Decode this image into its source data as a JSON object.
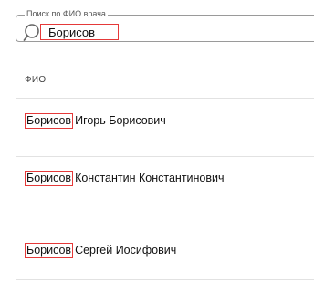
{
  "search": {
    "legend": "Поиск по ФИО врача",
    "value": "Борисов"
  },
  "table": {
    "column_header": "ФИО",
    "rows": [
      {
        "match": "Борисов",
        "rest": "Игорь Борисович"
      },
      {
        "match": "Борисов",
        "rest": "Константин Константинович"
      },
      {
        "match": "Борисов",
        "rest": "Сергей Иосифович"
      }
    ]
  },
  "colors": {
    "highlight": "#e53939",
    "border": "#9a9a9a",
    "divider": "#e2e2e2"
  }
}
